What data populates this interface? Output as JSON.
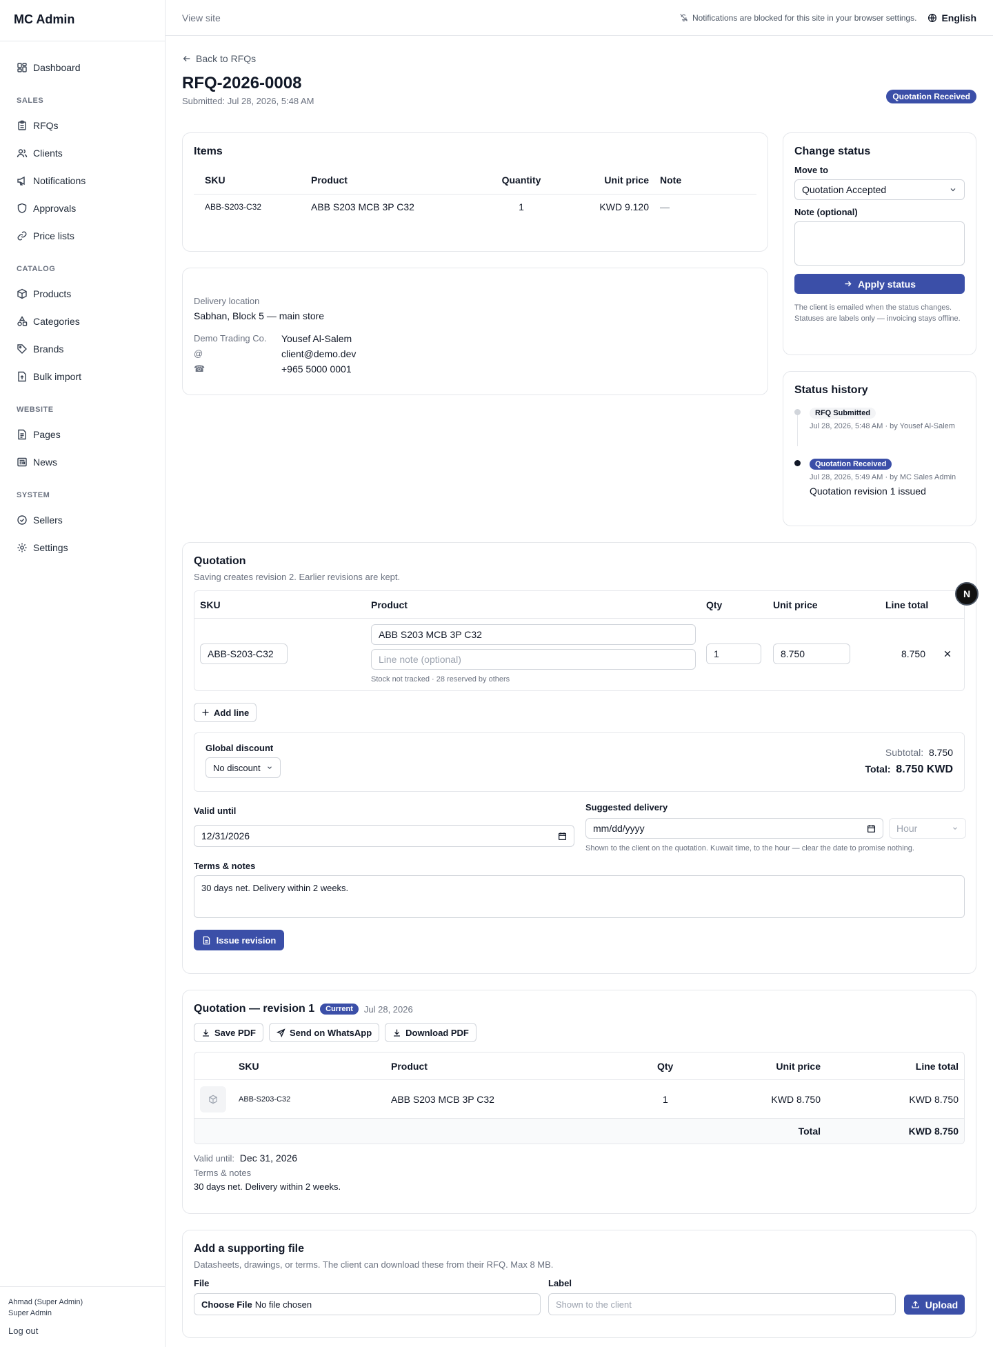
{
  "sidebar": {
    "brand": "MC Admin",
    "dashboard": "Dashboard",
    "sections": {
      "sales": "SALES",
      "catalog": "CATALOG",
      "website": "WEBSITE",
      "system": "SYSTEM"
    },
    "items": {
      "rfqs": "RFQs",
      "clients": "Clients",
      "notifications": "Notifications",
      "approvals": "Approvals",
      "price_lists": "Price lists",
      "products": "Products",
      "categories": "Categories",
      "brands": "Brands",
      "bulk_import": "Bulk import",
      "pages": "Pages",
      "news": "News",
      "sellers": "Sellers",
      "settings": "Settings"
    },
    "user_name": "Ahmad (Super Admin)",
    "user_role": "Super Admin",
    "logout": "Log out"
  },
  "topbar": {
    "view_site": "View site",
    "notice": "Notifications are blocked for this site in your browser settings.",
    "language": "English"
  },
  "page": {
    "back": "Back to RFQs",
    "title": "RFQ-2026-0008",
    "submitted": "Submitted: Jul 28, 2026, 5:48 AM",
    "status_badge": "Quotation Received"
  },
  "items": {
    "heading": "Items",
    "headers": {
      "sku": "SKU",
      "product": "Product",
      "quantity": "Quantity",
      "unit_price": "Unit price",
      "note": "Note"
    },
    "row": {
      "sku": "ABB-S203-C32",
      "product": "ABB S203 MCB 3P C32",
      "quantity": "1",
      "unit_price": "KWD 9.120",
      "note": "—"
    }
  },
  "delivery": {
    "label": "Delivery location",
    "value": "Sabhan, Block 5 — main store",
    "company": "Demo Trading Co.",
    "contact": "Yousef Al-Salem",
    "email_icon": "@",
    "email": "client@demo.dev",
    "phone_icon": "☎",
    "phone": "+965 5000 0001"
  },
  "change_status": {
    "heading": "Change status",
    "move_to_label": "Move to",
    "move_to_value": "Quotation Accepted",
    "note_label": "Note (optional)",
    "apply": "Apply status",
    "help": "The client is emailed when the status changes. Statuses are labels only — invoicing stays offline."
  },
  "history": {
    "heading": "Status history",
    "entries": [
      {
        "status": "RFQ Submitted",
        "meta": "Jul 28, 2026, 5:48 AM · by Yousef Al-Salem",
        "note": ""
      },
      {
        "status": "Quotation Received",
        "meta": "Jul 28, 2026, 5:49 AM · by MC Sales Admin",
        "note": "Quotation revision 1 issued"
      }
    ]
  },
  "quotation": {
    "heading": "Quotation",
    "subtitle": "Saving creates revision 2. Earlier revisions are kept.",
    "headers": {
      "sku": "SKU",
      "product": "Product",
      "qty": "Qty",
      "unit_price": "Unit price",
      "line_total": "Line total"
    },
    "line": {
      "sku": "ABB-S203-C32",
      "product": "ABB S203 MCB 3P C32",
      "note_placeholder": "Line note (optional)",
      "stock": "Stock not tracked · 28 reserved by others",
      "qty": "1",
      "unit_price": "8.750",
      "line_total": "8.750"
    },
    "add_line": "Add line",
    "discount_label": "Global discount",
    "discount_value": "No discount",
    "subtotal_label": "Subtotal:",
    "subtotal_value": "8.750",
    "total_label": "Total:",
    "total_value": "8.750 KWD",
    "valid_until_label": "Valid until",
    "valid_until_value": "12/31/2026",
    "suggested_delivery_label": "Suggested delivery",
    "suggested_delivery_placeholder": "mm/dd/yyyy",
    "hour_placeholder": "Hour",
    "delivery_help": "Shown to the client on the quotation. Kuwait time, to the hour — clear the date to promise nothing.",
    "terms_label": "Terms & notes",
    "terms_value": "30 days net. Delivery within 2 weeks.",
    "issue": "Issue revision"
  },
  "revision": {
    "heading": "Quotation — revision 1",
    "current": "Current",
    "date": "Jul 28, 2026",
    "save_pdf": "Save PDF",
    "whatsapp": "Send on WhatsApp",
    "download_pdf": "Download PDF",
    "headers": {
      "sku": "SKU",
      "product": "Product",
      "qty": "Qty",
      "unit_price": "Unit price",
      "line_total": "Line total"
    },
    "row": {
      "sku": "ABB-S203-C32",
      "product": "ABB S203 MCB 3P C32",
      "qty": "1",
      "unit_price": "KWD 8.750",
      "line_total": "KWD 8.750"
    },
    "total_label": "Total",
    "total_value": "KWD 8.750",
    "valid_until_label": "Valid until:",
    "valid_until_value": "Dec 31, 2026",
    "terms_label": "Terms & notes",
    "terms_value": "30 days net. Delivery within 2 weeks."
  },
  "upload": {
    "heading": "Add a supporting file",
    "subtitle": "Datasheets, drawings, or terms. The client can download these from their RFQ. Max 8 MB.",
    "file_label": "File",
    "choose": "Choose File",
    "no_file": "No file chosen",
    "label_label": "Label",
    "label_placeholder": "Shown to the client",
    "button": "Upload"
  },
  "floating_avatar": "N",
  "colors": {
    "accent": "#3b4fa8",
    "border": "#e5e7eb",
    "muted": "#6b7280"
  }
}
